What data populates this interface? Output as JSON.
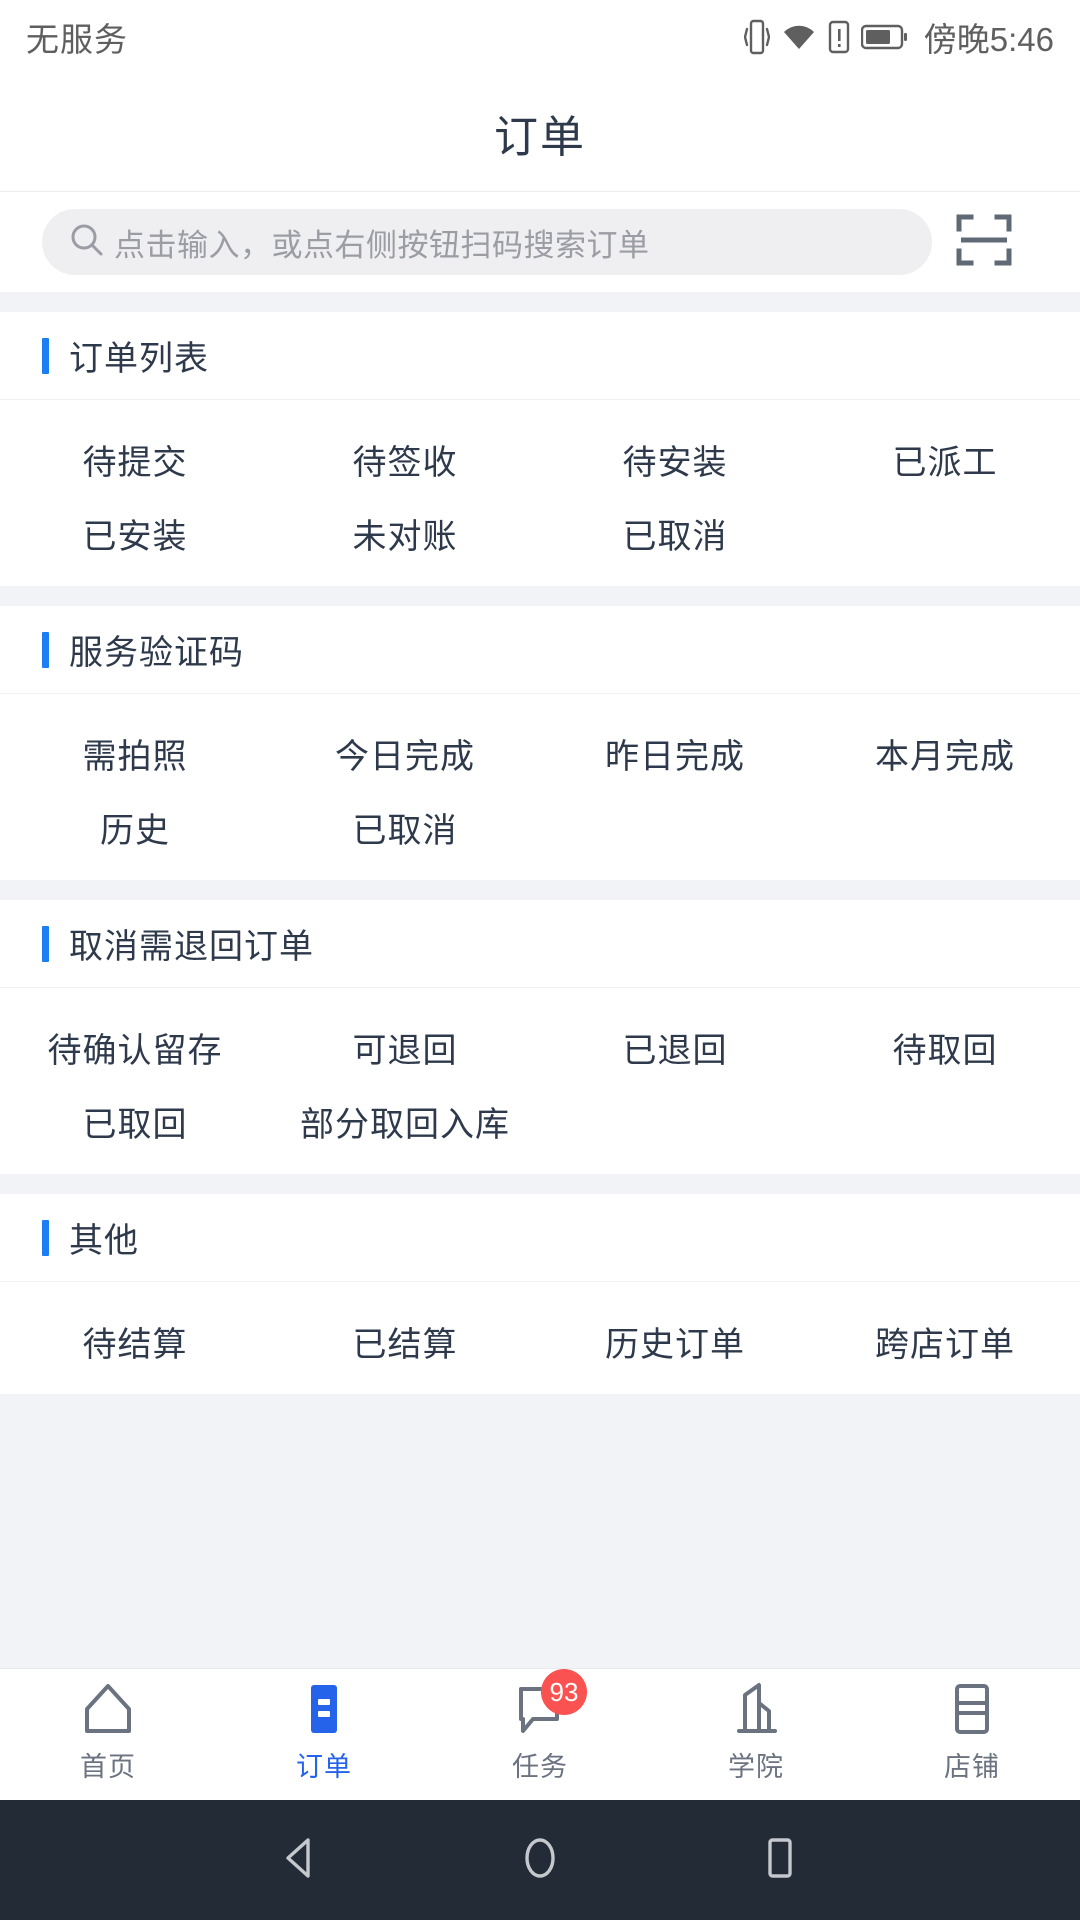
{
  "status_bar": {
    "carrier": "无服务",
    "time": "傍晚5:46",
    "icons": [
      "vibrate-icon",
      "wifi-icon",
      "sim-alert-icon",
      "battery-icon"
    ]
  },
  "header": {
    "title": "订单"
  },
  "search": {
    "placeholder": "点击输入，或点右侧按钮扫码搜索订单",
    "value": "",
    "scan_icon": "scan-code-icon",
    "search_icon": "search-icon"
  },
  "colors": {
    "accent": "#1b7ef2",
    "active_tab": "#2563eb",
    "badge": "#fa5151",
    "text": "#2e3a4b",
    "placeholder": "#9a9da3",
    "page_bg": "#f2f3f7",
    "navbar_bg": "#222b36"
  },
  "sections": [
    {
      "title": "订单列表",
      "items": [
        "待提交",
        "待签收",
        "待安装",
        "已派工",
        "已安装",
        "未对账",
        "已取消"
      ]
    },
    {
      "title": "服务验证码",
      "items": [
        "需拍照",
        "今日完成",
        "昨日完成",
        "本月完成",
        "历史",
        "已取消"
      ]
    },
    {
      "title": "取消需退回订单",
      "items": [
        "待确认留存",
        "可退回",
        "已退回",
        "待取回",
        "已取回",
        "部分取回入库"
      ]
    },
    {
      "title": "其他",
      "items": [
        "待结算",
        "已结算",
        "历史订单",
        "跨店订单"
      ]
    }
  ],
  "tabbar": [
    {
      "label": "首页",
      "icon": "home-icon",
      "active": false,
      "badge": ""
    },
    {
      "label": "订单",
      "icon": "orders-icon",
      "active": true,
      "badge": ""
    },
    {
      "label": "任务",
      "icon": "task-chat-icon",
      "active": false,
      "badge": "93"
    },
    {
      "label": "学院",
      "icon": "academy-building-icon",
      "active": false,
      "badge": ""
    },
    {
      "label": "店铺",
      "icon": "shop-icon",
      "active": false,
      "badge": ""
    }
  ],
  "android_nav": {
    "back": "back-triangle-icon",
    "home": "home-circle-icon",
    "recents": "recents-square-icon"
  }
}
